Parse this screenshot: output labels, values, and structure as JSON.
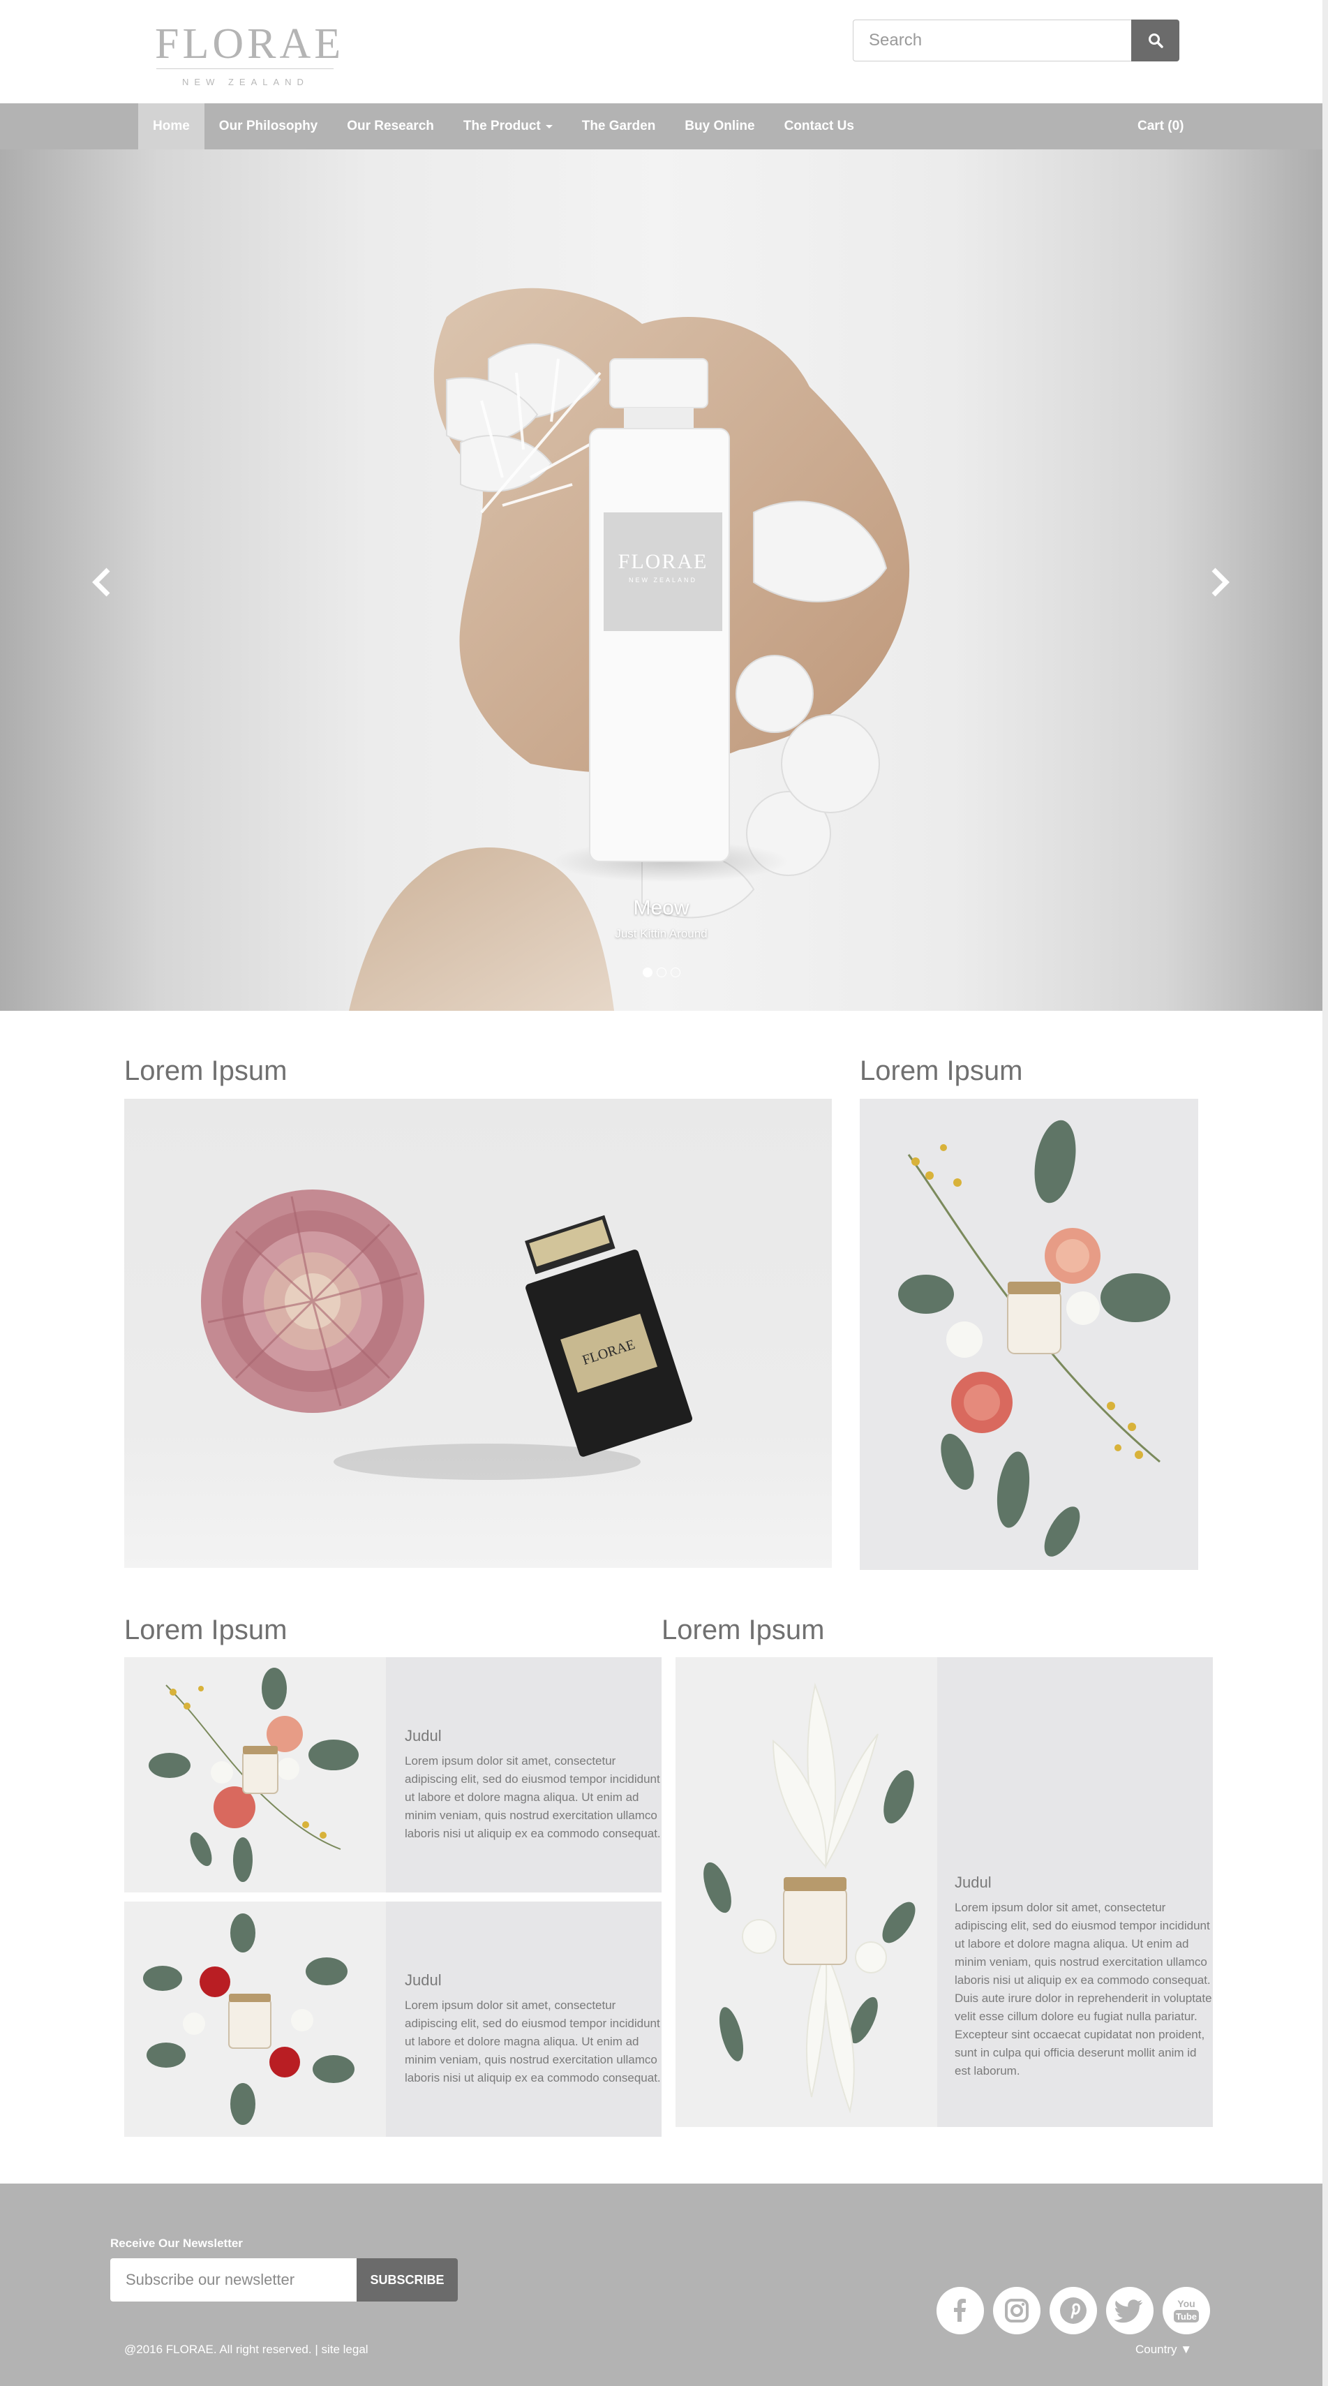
{
  "brand": {
    "name": "FLORAE",
    "tagline": "NEW ZEALAND"
  },
  "search": {
    "placeholder": "Search",
    "icon": "search-icon"
  },
  "nav": {
    "items": [
      {
        "label": "Home",
        "active": true
      },
      {
        "label": "Our Philosophy"
      },
      {
        "label": "Our Research"
      },
      {
        "label": "The Product",
        "dropdown": true
      },
      {
        "label": "The Garden"
      },
      {
        "label": "Buy Online"
      },
      {
        "label": "Contact Us"
      }
    ],
    "cart": "Cart (0)"
  },
  "hero": {
    "caption_title": "Meow",
    "caption_sub": "Just Kittin Around",
    "bottle_label": "FLORAE",
    "bottle_sub": "NEW ZEALAND",
    "slides": 3,
    "active_slide": 1
  },
  "sections": {
    "featured_left_title": "Lorem Ipsum",
    "featured_right_title": "Lorem Ipsum",
    "bottom_left_title": "Lorem Ipsum",
    "bottom_right_title": "Lorem Ipsum"
  },
  "cards": [
    {
      "heading": "Judul",
      "body": "Lorem ipsum dolor sit amet, consectetur adipiscing elit, sed do eiusmod tempor incididunt ut labore et dolore magna aliqua. Ut enim ad minim veniam, quis nostrud exercitation ullamco laboris nisi ut aliquip ex ea commodo consequat."
    },
    {
      "heading": "Judul",
      "body": "Lorem ipsum dolor sit amet, consectetur adipiscing elit, sed do eiusmod tempor incididunt ut labore et dolore magna aliqua. Ut enim ad minim veniam, quis nostrud exercitation ullamco laboris nisi ut aliquip ex ea commodo consequat."
    },
    {
      "heading": "Judul",
      "body": "Lorem ipsum dolor sit amet, consectetur adipiscing elit, sed do eiusmod tempor incididunt ut labore et dolore magna aliqua. Ut enim ad minim veniam, quis nostrud exercitation ullamco laboris nisi ut aliquip ex ea commodo consequat. Duis aute irure dolor in reprehenderit in voluptate velit esse cillum dolore eu fugiat nulla pariatur. Excepteur sint occaecat cupidatat non proident, sunt in culpa qui officia deserunt mollit anim id est laborum."
    }
  ],
  "product_label": "FLORAE",
  "footer": {
    "newsletter_label": "Receive Our Newsletter",
    "newsletter_placeholder": "Subscribe our newsletter",
    "subscribe": "SUBSCRIBE",
    "copyright": "@2016 FLORAE. All right reserved. | site legal",
    "country": "Country ▼",
    "social": [
      "facebook-icon",
      "instagram-icon",
      "pinterest-icon",
      "twitter-icon",
      "youtube-icon"
    ],
    "youtube_text": "You Tube"
  },
  "colors": {
    "nav_bg": "#b3b3b3",
    "nav_active": "#d3d3d3",
    "button_dark": "#6b6b6b",
    "card_bg": "#e6e6e8",
    "heading_gray": "#707070"
  }
}
